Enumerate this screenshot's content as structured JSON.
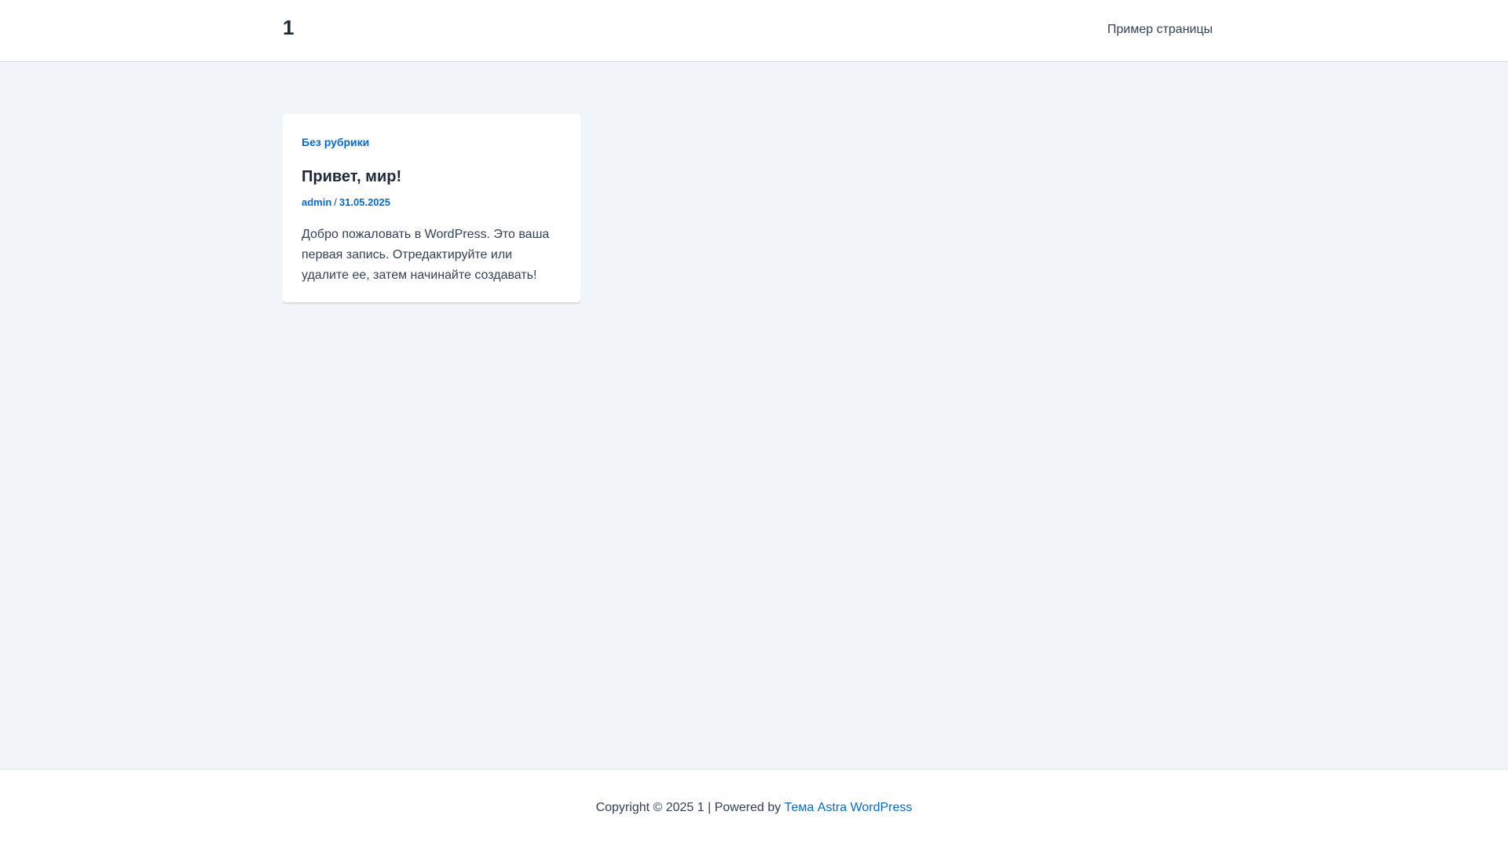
{
  "header": {
    "site_title": "1",
    "nav_item": "Пример страницы"
  },
  "post": {
    "category": "Без рубрики",
    "title": "Привет, мир!",
    "author": "admin",
    "meta_separator": "/",
    "date": "31.05.2025",
    "excerpt": "Добро пожаловать в WordPress. Это ваша первая запись. Отредактируйте или удалите ее, затем начинайте создавать!"
  },
  "footer": {
    "copyright": "Copyright © 2025 1 | Powered by ",
    "theme_link": "Тема Astra WordPress"
  },
  "colors": {
    "accent": "#046bd2",
    "heading": "#1e293b",
    "text": "#334155",
    "background": "#f0f5fa"
  }
}
